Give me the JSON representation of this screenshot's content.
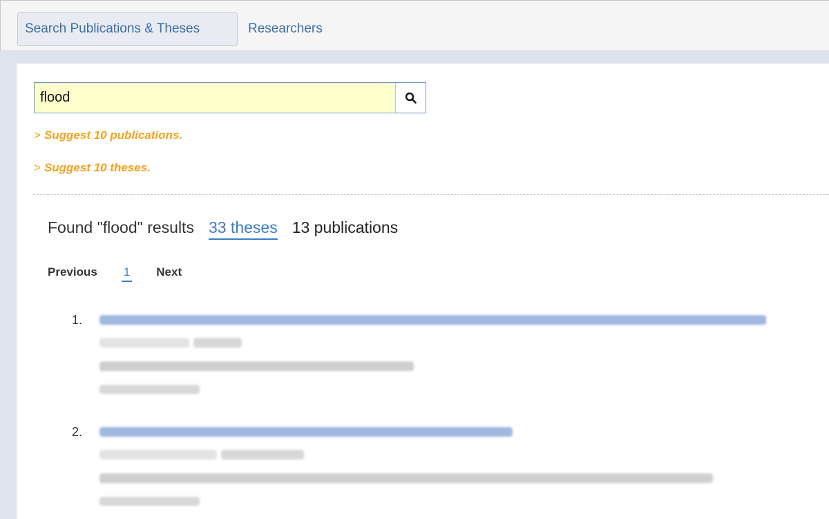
{
  "tabs": [
    {
      "label": "Search Publications & Theses",
      "active": true
    },
    {
      "label": "Researchers",
      "active": false
    }
  ],
  "search": {
    "value": "flood",
    "button_icon": "search-icon"
  },
  "suggestions": [
    {
      "chevron": ">",
      "label": "Suggest 10 publications."
    },
    {
      "chevron": ">",
      "label": "Suggest 10 theses."
    }
  ],
  "results_summary": {
    "prefix": "Found \"flood\" results",
    "theses": "33 theses",
    "publications": "13 publications"
  },
  "pagination": {
    "previous": "Previous",
    "page": "1",
    "next": "Next"
  },
  "results": [
    {
      "number": "1."
    },
    {
      "number": "2."
    }
  ],
  "colors": {
    "accent": "#3a7cc6",
    "suggest": "#f0a21e",
    "search_bg": "#ffffcc",
    "page_bg": "#dfe3ec"
  }
}
